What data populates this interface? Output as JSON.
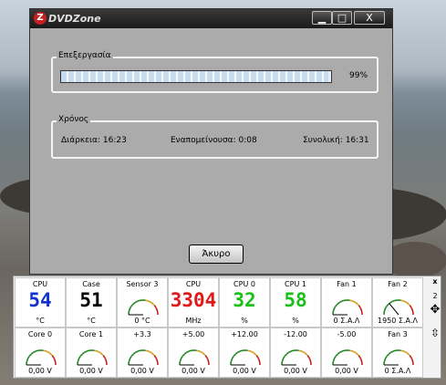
{
  "window": {
    "title": "DVDZone",
    "logo_letter": "Z",
    "minimize": "▁",
    "maximize": "□",
    "close": "X"
  },
  "progress_group": {
    "label": "Επεξεργασία",
    "percent_text": "99%",
    "progress": 0.99
  },
  "time_group": {
    "label": "Χρόνος",
    "duration": "Διάρκεια: 16:23",
    "remaining": "Εναπομείνουσα: 0:08",
    "total": "Συνολική: 16:31"
  },
  "cancel_label": "Άκυρο",
  "monitor": {
    "row1": [
      {
        "label": "CPU",
        "type": "digital",
        "value": "54",
        "unit": "°C",
        "color": "#1030d0"
      },
      {
        "label": "Case",
        "type": "digital",
        "value": "51",
        "unit": "°C",
        "color": "#000000"
      },
      {
        "label": "Sensor 3",
        "type": "gauge",
        "level": 0.0,
        "unit": "0 °C"
      },
      {
        "label": "CPU",
        "type": "digital",
        "value": "3304",
        "unit": "MHz",
        "color": "#e01818"
      },
      {
        "label": "CPU 0",
        "type": "digital",
        "value": "32",
        "unit": "%",
        "color": "#18c018"
      },
      {
        "label": "CPU 1",
        "type": "digital",
        "value": "58",
        "unit": "%",
        "color": "#18c018"
      },
      {
        "label": "Fan 1",
        "type": "gauge",
        "level": 0.0,
        "unit": "0 Σ.Α.Λ"
      },
      {
        "label": "Fan 2",
        "type": "gauge",
        "level": 0.28,
        "unit": "1950 Σ.Α.Λ"
      }
    ],
    "row2": [
      {
        "label": "Core 0",
        "type": "gauge",
        "level": 0.0,
        "unit": "0,00 V"
      },
      {
        "label": "Core 1",
        "type": "gauge",
        "level": 0.0,
        "unit": "0,00 V"
      },
      {
        "label": "+3.3",
        "type": "gauge",
        "level": 0.0,
        "unit": "0,00 V"
      },
      {
        "label": "+5.00",
        "type": "gauge",
        "level": 0.0,
        "unit": "0,00 V"
      },
      {
        "label": "+12.00",
        "type": "gauge",
        "level": 0.0,
        "unit": "0,00 V"
      },
      {
        "label": "-12.00",
        "type": "gauge",
        "level": 0.0,
        "unit": "0,00 V"
      },
      {
        "label": "-5.00",
        "type": "gauge",
        "level": 0.0,
        "unit": "0,00 V"
      },
      {
        "label": "Fan 3",
        "type": "gauge",
        "level": 0.0,
        "unit": "0 Σ.Α.Λ"
      }
    ],
    "side_close": "x",
    "side_page": "2",
    "side_move": "✥",
    "side_scroll": "⇳"
  }
}
